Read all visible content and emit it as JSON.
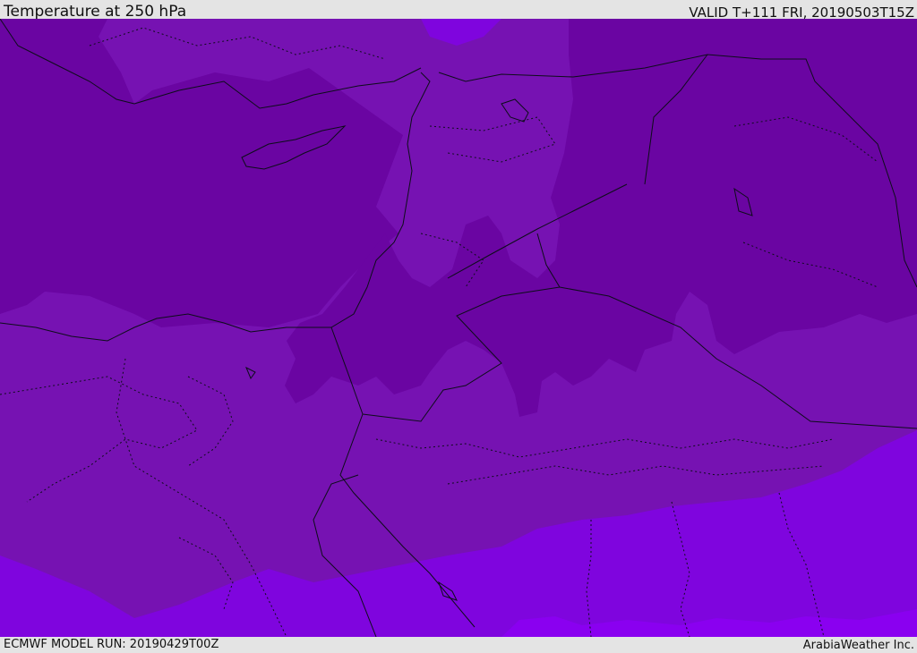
{
  "header": {
    "title": "Temperature at 250 hPa",
    "valid": "VALID T+111 FRI, 20190503T15Z"
  },
  "footer": {
    "model_run": "ECMWF MODEL RUN: 20190429T00Z",
    "credit": "ArabiaWeather Inc."
  },
  "colors": {
    "band_cold": "#6a05a2",
    "band_mid": "#7612b2",
    "band_warm": "#7f05de",
    "band_warmest": "#8a00f0",
    "coastline": "#0d0d1a",
    "frame": "#e4e4e4"
  }
}
